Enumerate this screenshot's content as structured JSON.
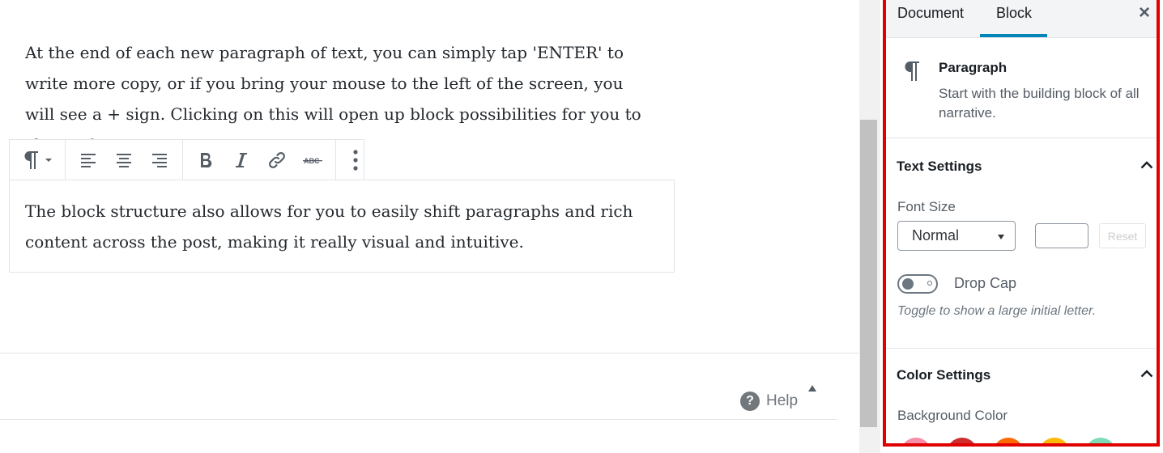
{
  "editor": {
    "paragraph1": [
      "At the end of each new paragraph of text, you can simply tap 'ENTER' to",
      "write more copy, or if you bring your mouse to the left of the screen, you",
      "will see a + sign. Clicking on this will open up block possibilities for you to",
      "choose from."
    ],
    "paragraph2": [
      "The block structure also allows for you to easily shift paragraphs and rich",
      "content across the post, making it really visual and intuitive."
    ],
    "toolbar": {
      "icons": [
        "paragraph-icon",
        "chevron-down-icon",
        "align-left-icon",
        "align-center-icon",
        "align-right-icon",
        "bold-icon",
        "italic-icon",
        "link-icon",
        "strikethrough-icon",
        "more-options-icon"
      ]
    },
    "help_label": "Help",
    "help_mark": "?"
  },
  "sidebar": {
    "tabs": [
      {
        "label": "Document"
      },
      {
        "label": "Block"
      }
    ],
    "active_tab": "Block",
    "close_glyph": "×",
    "block_card": {
      "title": "Paragraph",
      "description": "Start with the building block of all narrative."
    },
    "text_settings": {
      "title": "Text Settings",
      "font_size_label": "Font Size",
      "font_size_value": "Normal",
      "custom_size_value": "",
      "reset_label": "Reset",
      "drop_cap_label": "Drop Cap",
      "drop_cap_help": "Toggle to show a large initial letter.",
      "drop_cap_enabled": false
    },
    "color_settings": {
      "title": "Color Settings",
      "background_label": "Background Color",
      "swatches": [
        "#f78da7",
        "#cf2e2e",
        "#ff6900",
        "#fcb900",
        "#7bdcb5"
      ]
    }
  },
  "colors": {
    "accent": "#0085ba",
    "highlight_border": "#e00000"
  }
}
